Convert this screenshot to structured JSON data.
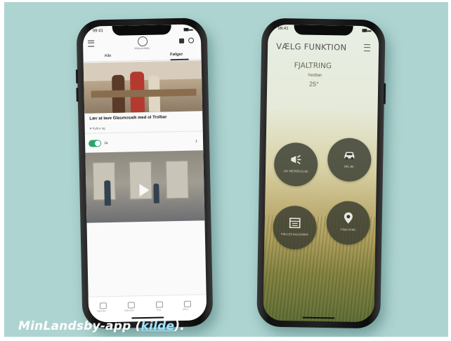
{
  "caption": {
    "text": "MinLandsby-app (",
    "link": "kilde",
    "end": ")."
  },
  "left_phone": {
    "status_time": "09:41",
    "logo_text": "MinLandsby",
    "tab_left": "Alle",
    "tab_right": "Følger",
    "headline": "Lær at lave Glasmosaik med ol Trolbar",
    "meta": "♥ Kultur og",
    "toggle_label": "Ja",
    "count": "1",
    "tab_labels": [
      "Nyheder",
      "Kalender",
      "Ting",
      "Mere"
    ]
  },
  "right_phone": {
    "status_time": "09:41",
    "title": "VÆLG FUNKTION",
    "mode": "FJALTRING",
    "subtitle": "Nedbør",
    "value": "25°",
    "buttons": [
      {
        "icon": "megaphone-icon",
        "label": "GIV MEDDEL­ELSE"
      },
      {
        "icon": "car-icon",
        "label": "DEL BIL"
      },
      {
        "icon": "calendar-icon",
        "label": "FÆLLES KALENDER"
      },
      {
        "icon": "location-pin-icon",
        "label": "FIND STED"
      }
    ]
  },
  "colors": {
    "background": "#aed4d1",
    "toggle": "#2fa36f",
    "circle": "#373a30",
    "link": "#9fe6ff"
  }
}
